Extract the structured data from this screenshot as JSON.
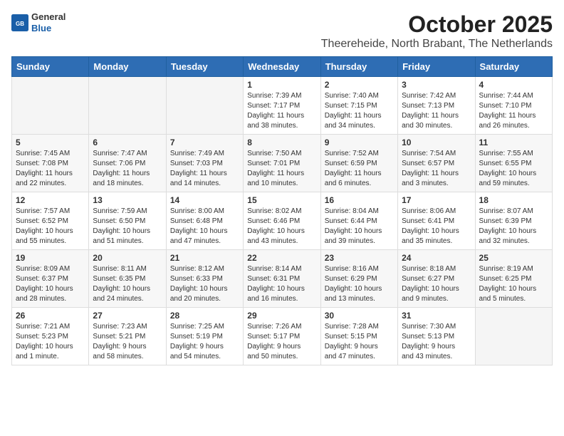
{
  "logo": {
    "general": "General",
    "blue": "Blue"
  },
  "title": "October 2025",
  "subtitle": "Theereheide, North Brabant, The Netherlands",
  "days_of_week": [
    "Sunday",
    "Monday",
    "Tuesday",
    "Wednesday",
    "Thursday",
    "Friday",
    "Saturday"
  ],
  "weeks": [
    [
      {
        "day": "",
        "info": ""
      },
      {
        "day": "",
        "info": ""
      },
      {
        "day": "",
        "info": ""
      },
      {
        "day": "1",
        "info": "Sunrise: 7:39 AM\nSunset: 7:17 PM\nDaylight: 11 hours\nand 38 minutes."
      },
      {
        "day": "2",
        "info": "Sunrise: 7:40 AM\nSunset: 7:15 PM\nDaylight: 11 hours\nand 34 minutes."
      },
      {
        "day": "3",
        "info": "Sunrise: 7:42 AM\nSunset: 7:13 PM\nDaylight: 11 hours\nand 30 minutes."
      },
      {
        "day": "4",
        "info": "Sunrise: 7:44 AM\nSunset: 7:10 PM\nDaylight: 11 hours\nand 26 minutes."
      }
    ],
    [
      {
        "day": "5",
        "info": "Sunrise: 7:45 AM\nSunset: 7:08 PM\nDaylight: 11 hours\nand 22 minutes."
      },
      {
        "day": "6",
        "info": "Sunrise: 7:47 AM\nSunset: 7:06 PM\nDaylight: 11 hours\nand 18 minutes."
      },
      {
        "day": "7",
        "info": "Sunrise: 7:49 AM\nSunset: 7:03 PM\nDaylight: 11 hours\nand 14 minutes."
      },
      {
        "day": "8",
        "info": "Sunrise: 7:50 AM\nSunset: 7:01 PM\nDaylight: 11 hours\nand 10 minutes."
      },
      {
        "day": "9",
        "info": "Sunrise: 7:52 AM\nSunset: 6:59 PM\nDaylight: 11 hours\nand 6 minutes."
      },
      {
        "day": "10",
        "info": "Sunrise: 7:54 AM\nSunset: 6:57 PM\nDaylight: 11 hours\nand 3 minutes."
      },
      {
        "day": "11",
        "info": "Sunrise: 7:55 AM\nSunset: 6:55 PM\nDaylight: 10 hours\nand 59 minutes."
      }
    ],
    [
      {
        "day": "12",
        "info": "Sunrise: 7:57 AM\nSunset: 6:52 PM\nDaylight: 10 hours\nand 55 minutes."
      },
      {
        "day": "13",
        "info": "Sunrise: 7:59 AM\nSunset: 6:50 PM\nDaylight: 10 hours\nand 51 minutes."
      },
      {
        "day": "14",
        "info": "Sunrise: 8:00 AM\nSunset: 6:48 PM\nDaylight: 10 hours\nand 47 minutes."
      },
      {
        "day": "15",
        "info": "Sunrise: 8:02 AM\nSunset: 6:46 PM\nDaylight: 10 hours\nand 43 minutes."
      },
      {
        "day": "16",
        "info": "Sunrise: 8:04 AM\nSunset: 6:44 PM\nDaylight: 10 hours\nand 39 minutes."
      },
      {
        "day": "17",
        "info": "Sunrise: 8:06 AM\nSunset: 6:41 PM\nDaylight: 10 hours\nand 35 minutes."
      },
      {
        "day": "18",
        "info": "Sunrise: 8:07 AM\nSunset: 6:39 PM\nDaylight: 10 hours\nand 32 minutes."
      }
    ],
    [
      {
        "day": "19",
        "info": "Sunrise: 8:09 AM\nSunset: 6:37 PM\nDaylight: 10 hours\nand 28 minutes."
      },
      {
        "day": "20",
        "info": "Sunrise: 8:11 AM\nSunset: 6:35 PM\nDaylight: 10 hours\nand 24 minutes."
      },
      {
        "day": "21",
        "info": "Sunrise: 8:12 AM\nSunset: 6:33 PM\nDaylight: 10 hours\nand 20 minutes."
      },
      {
        "day": "22",
        "info": "Sunrise: 8:14 AM\nSunset: 6:31 PM\nDaylight: 10 hours\nand 16 minutes."
      },
      {
        "day": "23",
        "info": "Sunrise: 8:16 AM\nSunset: 6:29 PM\nDaylight: 10 hours\nand 13 minutes."
      },
      {
        "day": "24",
        "info": "Sunrise: 8:18 AM\nSunset: 6:27 PM\nDaylight: 10 hours\nand 9 minutes."
      },
      {
        "day": "25",
        "info": "Sunrise: 8:19 AM\nSunset: 6:25 PM\nDaylight: 10 hours\nand 5 minutes."
      }
    ],
    [
      {
        "day": "26",
        "info": "Sunrise: 7:21 AM\nSunset: 5:23 PM\nDaylight: 10 hours\nand 1 minute."
      },
      {
        "day": "27",
        "info": "Sunrise: 7:23 AM\nSunset: 5:21 PM\nDaylight: 9 hours\nand 58 minutes."
      },
      {
        "day": "28",
        "info": "Sunrise: 7:25 AM\nSunset: 5:19 PM\nDaylight: 9 hours\nand 54 minutes."
      },
      {
        "day": "29",
        "info": "Sunrise: 7:26 AM\nSunset: 5:17 PM\nDaylight: 9 hours\nand 50 minutes."
      },
      {
        "day": "30",
        "info": "Sunrise: 7:28 AM\nSunset: 5:15 PM\nDaylight: 9 hours\nand 47 minutes."
      },
      {
        "day": "31",
        "info": "Sunrise: 7:30 AM\nSunset: 5:13 PM\nDaylight: 9 hours\nand 43 minutes."
      },
      {
        "day": "",
        "info": ""
      }
    ]
  ]
}
